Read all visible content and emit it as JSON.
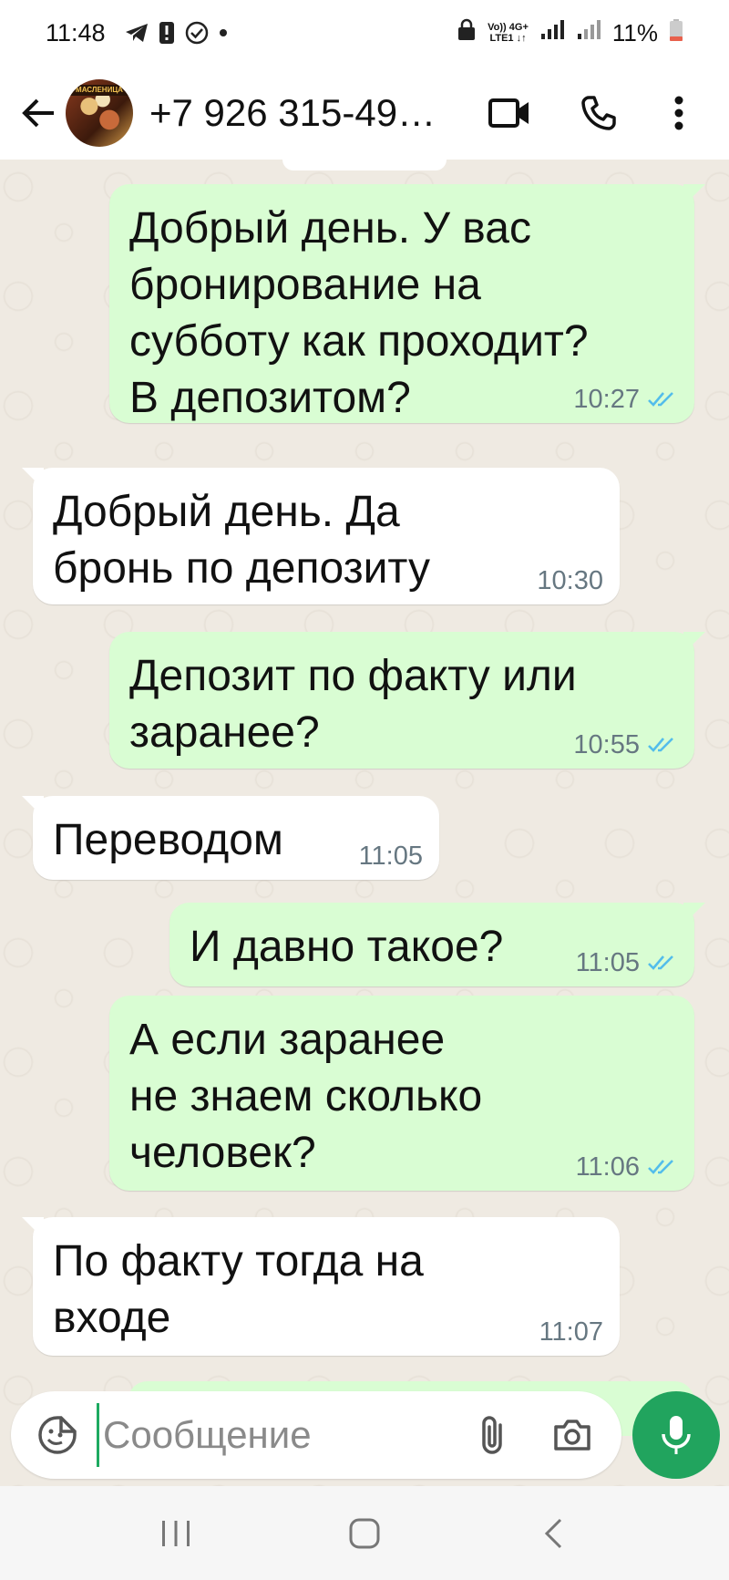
{
  "status_bar": {
    "time": "11:48",
    "network_top": "Vo)) 4G+",
    "network_bottom": "LTE1 ↓↑",
    "battery": "11%"
  },
  "header": {
    "contact_name": "+7 926 315-49…",
    "avatar_text": "МАСЛЕНИЦА"
  },
  "messages": [
    {
      "direction": "out",
      "text": "Добрый день. У вас\nбронирование на\nсубботу как проходит?\nВ депозитом?",
      "time": "10:27",
      "read": true
    },
    {
      "direction": "in",
      "text": "Добрый день. Да\nбронь по депозиту",
      "time": "10:30"
    },
    {
      "direction": "out",
      "text": "Депозит по факту или\nзаранее?",
      "time": "10:55",
      "read": true
    },
    {
      "direction": "in",
      "text": "Переводом",
      "time": "11:05"
    },
    {
      "direction": "out",
      "text": "И давно такое?",
      "time": "11:05",
      "read": true
    },
    {
      "direction": "out",
      "text": "А если заранее\nне знаем сколько\nчеловек?",
      "time": "11:06",
      "read": true
    },
    {
      "direction": "in",
      "text": "По факту тогда на\nвходе",
      "time": "11:07"
    }
  ],
  "composer": {
    "placeholder": "Сообщение"
  },
  "colors": {
    "outgoing_bubble": "#d9fdd3",
    "incoming_bubble": "#ffffff",
    "chat_background": "#efeae2",
    "read_ticks": "#53bdeb",
    "mic_button": "#21a45e"
  }
}
